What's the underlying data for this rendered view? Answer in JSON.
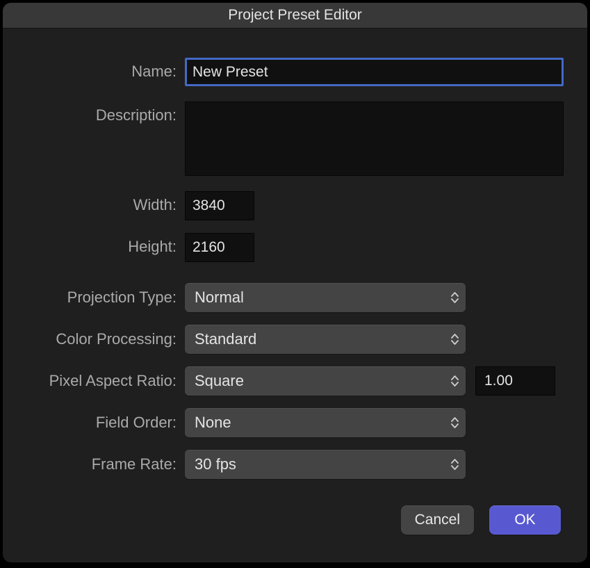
{
  "title": "Project Preset Editor",
  "labels": {
    "name": "Name:",
    "description": "Description:",
    "width": "Width:",
    "height": "Height:",
    "projectionType": "Projection Type:",
    "colorProcessing": "Color Processing:",
    "pixelAspectRatio": "Pixel Aspect Ratio:",
    "fieldOrder": "Field Order:",
    "frameRate": "Frame Rate:"
  },
  "values": {
    "name": "New Preset",
    "description": "",
    "width": "3840",
    "height": "2160",
    "projectionType": "Normal",
    "colorProcessing": "Standard",
    "pixelAspectRatio": "Square",
    "pixelAspectRatioValue": "1.00",
    "fieldOrder": "None",
    "frameRate": "30 fps"
  },
  "buttons": {
    "cancel": "Cancel",
    "ok": "OK"
  }
}
